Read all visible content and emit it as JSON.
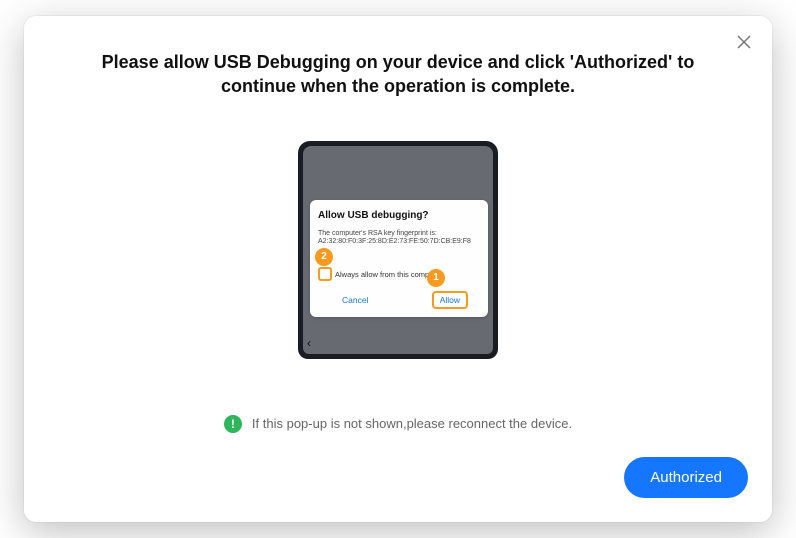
{
  "modal": {
    "title": "Please allow USB Debugging on your device and click 'Authorized' to continue when the operation is complete."
  },
  "phone": {
    "dialog": {
      "title": "Allow USB debugging?",
      "subtitle": "The computer's RSA key fingerprint is:",
      "fingerprint": "A2:32:80:F0:3F:25:8D:E2:73:FE:50:7D:CB:E9:F8",
      "checkbox_label": "Always allow from this computer",
      "cancel": "Cancel",
      "allow": "Allow"
    },
    "annotations": {
      "step1": "1",
      "step2": "2"
    }
  },
  "info": {
    "icon_glyph": "!",
    "text": "If this pop-up is not shown,please reconnect the device."
  },
  "actions": {
    "authorized": "Authorized"
  }
}
